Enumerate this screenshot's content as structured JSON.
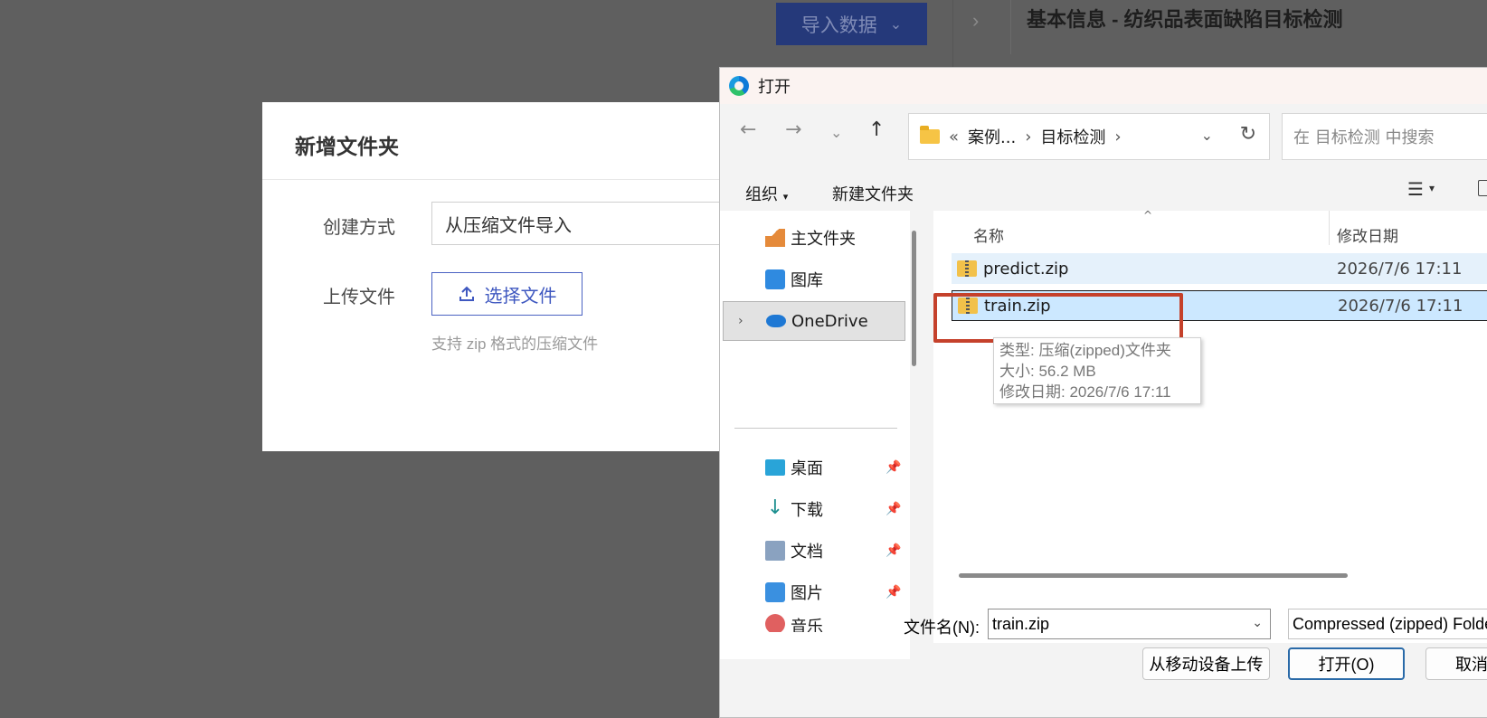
{
  "background": {
    "import_button": "导入数据",
    "header_title": "基本信息 - 纺织品表面缺陷目标检测"
  },
  "modal": {
    "title": "新增文件夹",
    "method_label": "创建方式",
    "method_value": "从压缩文件导入",
    "upload_label": "上传文件",
    "upload_button": "选择文件",
    "upload_hint": "支持 zip 格式的压缩文件"
  },
  "dialog": {
    "title": "打开",
    "address": {
      "prefix": "«",
      "crumbs": [
        "案例...",
        "目标检测"
      ]
    },
    "search_placeholder": "在 目标检测 中搜索",
    "toolbar": {
      "organize": "组织",
      "new_folder": "新建文件夹"
    },
    "nav_items": {
      "home": "主文件夹",
      "gallery": "图库",
      "onedrive": "OneDrive",
      "desktop": "桌面",
      "downloads": "下载",
      "documents": "文档",
      "pictures": "图片",
      "music": "音乐"
    },
    "columns": {
      "name": "名称",
      "date": "修改日期"
    },
    "files": [
      {
        "name": "predict.zip",
        "date": "2026/7/6 17:11"
      },
      {
        "name": "train.zip",
        "date": "2026/7/6 17:11"
      }
    ],
    "tooltip": {
      "type": "类型: 压缩(zipped)文件夹",
      "size": "大小: 56.2 MB",
      "modified": "修改日期: 2026/7/6 17:11"
    },
    "filename_label": "文件名(N):",
    "filename_value": "train.zip",
    "filetype_value": "Compressed (zipped) Folder",
    "buttons": {
      "mobile_upload": "从移动设备上传",
      "open": "打开(O)",
      "cancel": "取消"
    }
  }
}
